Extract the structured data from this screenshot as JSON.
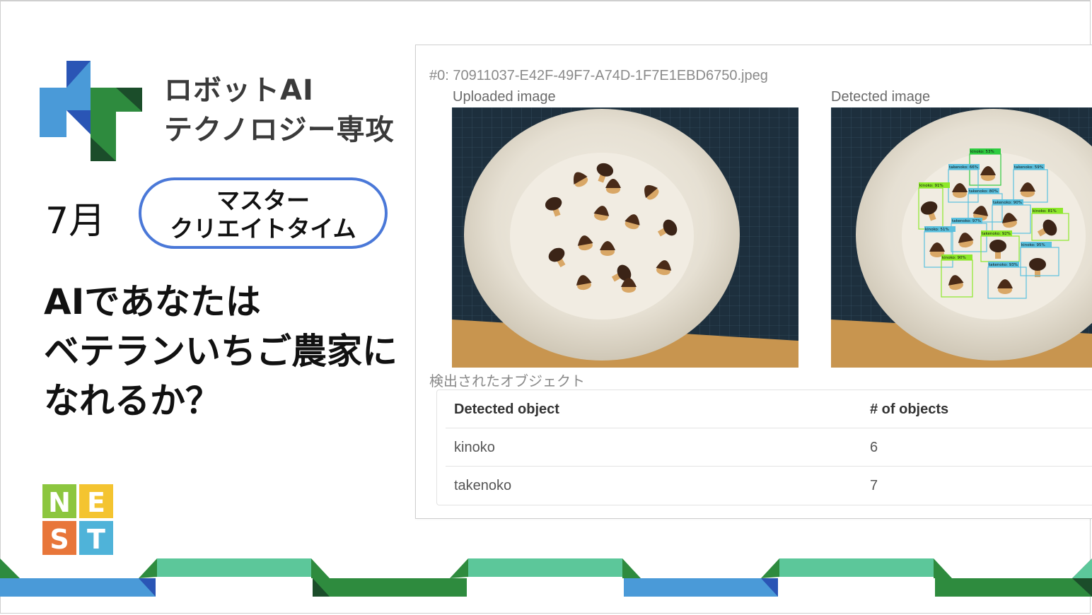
{
  "brand": {
    "title_line1": "ロボットAI",
    "title_line2": "テクノロジー専攻",
    "colors": {
      "blue": "#4a9ad8",
      "green": "#2e8b3e",
      "dark": "#1b4d2a",
      "light_green": "#5cc79a",
      "navy": "#2a55b5"
    }
  },
  "month": "7月",
  "event": {
    "line1": "マスター",
    "line2": "クリエイトタイム"
  },
  "headline": {
    "line1": "AIであなたは",
    "line2": "ベテランいちご農家に",
    "line3": "なれるか？"
  },
  "nest_logo": {
    "letters": [
      "N",
      "E",
      "S",
      "T"
    ]
  },
  "result": {
    "filename": "#0: 70911037-E42F-49F7-A74D-1F7E1EBD6750.jpeg",
    "uploaded_caption": "Uploaded image",
    "detected_caption": "Detected image",
    "objects_title": "検出されたオブジェクト",
    "table": {
      "headers": [
        "Detected object",
        "# of objects"
      ],
      "rows": [
        {
          "name": "kinoko",
          "count": "6"
        },
        {
          "name": "takenoko",
          "count": "7"
        }
      ]
    },
    "detections": [
      "kinoko: 53%",
      "takenoko: 66%",
      "takenoko: 59%",
      "kinoko: 91%",
      "takenoko: 80%",
      "takenoko: 90%",
      "kinoko: 81%",
      "takenoko: 97%",
      "takenoko: 92%",
      "kinoko: 51%",
      "kinoko: 95%",
      "kinoko: 90%",
      "takenoko: 93%"
    ]
  }
}
